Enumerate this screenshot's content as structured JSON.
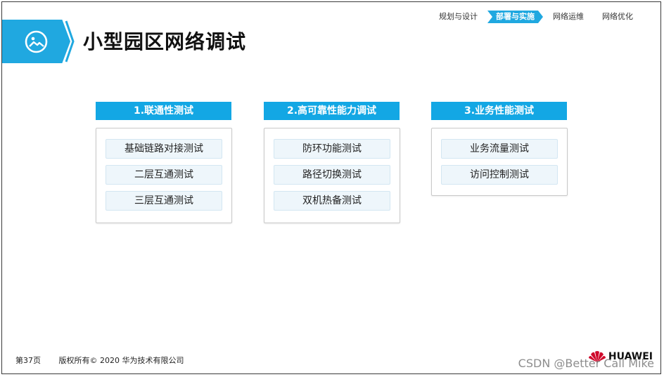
{
  "header": {
    "title": "小型园区网络调试",
    "nav_steps": [
      {
        "label": "规划与设计",
        "active": false
      },
      {
        "label": "部署与实施",
        "active": true
      },
      {
        "label": "网络运维",
        "active": false
      },
      {
        "label": "网络优化",
        "active": false
      }
    ]
  },
  "columns": [
    {
      "header": "1.联通性测试",
      "items": [
        "基础链路对接测试",
        "二层互通测试",
        "三层互通测试"
      ]
    },
    {
      "header": "2.高可靠性能力调试",
      "items": [
        "防环功能测试",
        "路径切换测试",
        "双机热备测试"
      ]
    },
    {
      "header": "3.业务性能测试",
      "items": [
        "业务流量测试",
        "访问控制测试"
      ]
    }
  ],
  "footer": {
    "page": "第37页",
    "copyright": "版权所有© 2020 华为技术有限公司",
    "watermark": "CSDN @Better Call Mike",
    "logo_text": "HUAWEI"
  },
  "colors": {
    "accent": "#13a7e4",
    "item_bg": "#eef6fb"
  }
}
